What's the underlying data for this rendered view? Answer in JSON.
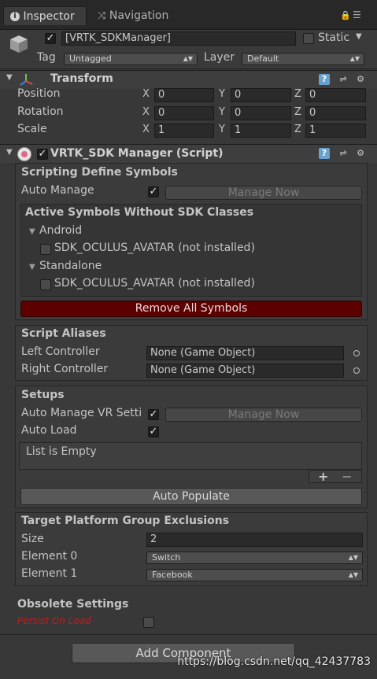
{
  "tabs": [
    {
      "label": "Inspector",
      "icon": "info-icon"
    },
    {
      "label": "Navigation",
      "icon": "navigation-icon"
    }
  ],
  "header": {
    "object_name": "[VRTK_SDKManager]",
    "static_label": "Static",
    "tag_label": "Tag",
    "tag_value": "Untagged",
    "layer_label": "Layer",
    "layer_value": "Default"
  },
  "transform": {
    "title": "Transform",
    "rows": [
      {
        "label": "Position",
        "x": "0",
        "y": "0",
        "z": "0"
      },
      {
        "label": "Rotation",
        "x": "0",
        "y": "0",
        "z": "0"
      },
      {
        "label": "Scale",
        "x": "1",
        "y": "1",
        "z": "1"
      }
    ],
    "axis": {
      "x": "X",
      "y": "Y",
      "z": "Z"
    }
  },
  "sdk_manager": {
    "title": "VRTK_SDK Manager (Script)",
    "define_symbols": {
      "heading": "Scripting Define Symbols",
      "auto_manage_label": "Auto Manage",
      "manage_now_label": "Manage Now",
      "active_symbols_heading": "Active Symbols Without SDK Classes",
      "groups": [
        {
          "name": "Android",
          "item": "SDK_OCULUS_AVATAR (not installed)"
        },
        {
          "name": "Standalone",
          "item": "SDK_OCULUS_AVATAR (not installed)"
        }
      ],
      "remove_all_label": "Remove All Symbols"
    },
    "aliases": {
      "heading": "Script Aliases",
      "left_label": "Left Controller",
      "left_value": "None (Game Object)",
      "right_label": "Right Controller",
      "right_value": "None (Game Object)"
    },
    "setups": {
      "heading": "Setups",
      "auto_manage_vr_label": "Auto Manage VR Setti",
      "manage_now_label": "Manage Now",
      "auto_load_label": "Auto Load",
      "list_empty": "List is Empty",
      "add_symbol": "+",
      "remove_symbol": "−",
      "auto_populate_label": "Auto Populate"
    },
    "exclusions": {
      "heading": "Target Platform Group Exclusions",
      "size_label": "Size",
      "size_value": "2",
      "elements": [
        {
          "label": "Element 0",
          "value": "Switch"
        },
        {
          "label": "Element 1",
          "value": "Facebook"
        }
      ]
    },
    "obsolete": {
      "heading": "Obsolete Settings",
      "persist_label": "Persist On Load"
    }
  },
  "add_component_label": "Add Component",
  "watermark": "https://blog.csdn.net/qq_42437783",
  "colors": {
    "background": "#383838",
    "danger": "#5c0000",
    "persist_label": "#c41a1a"
  }
}
